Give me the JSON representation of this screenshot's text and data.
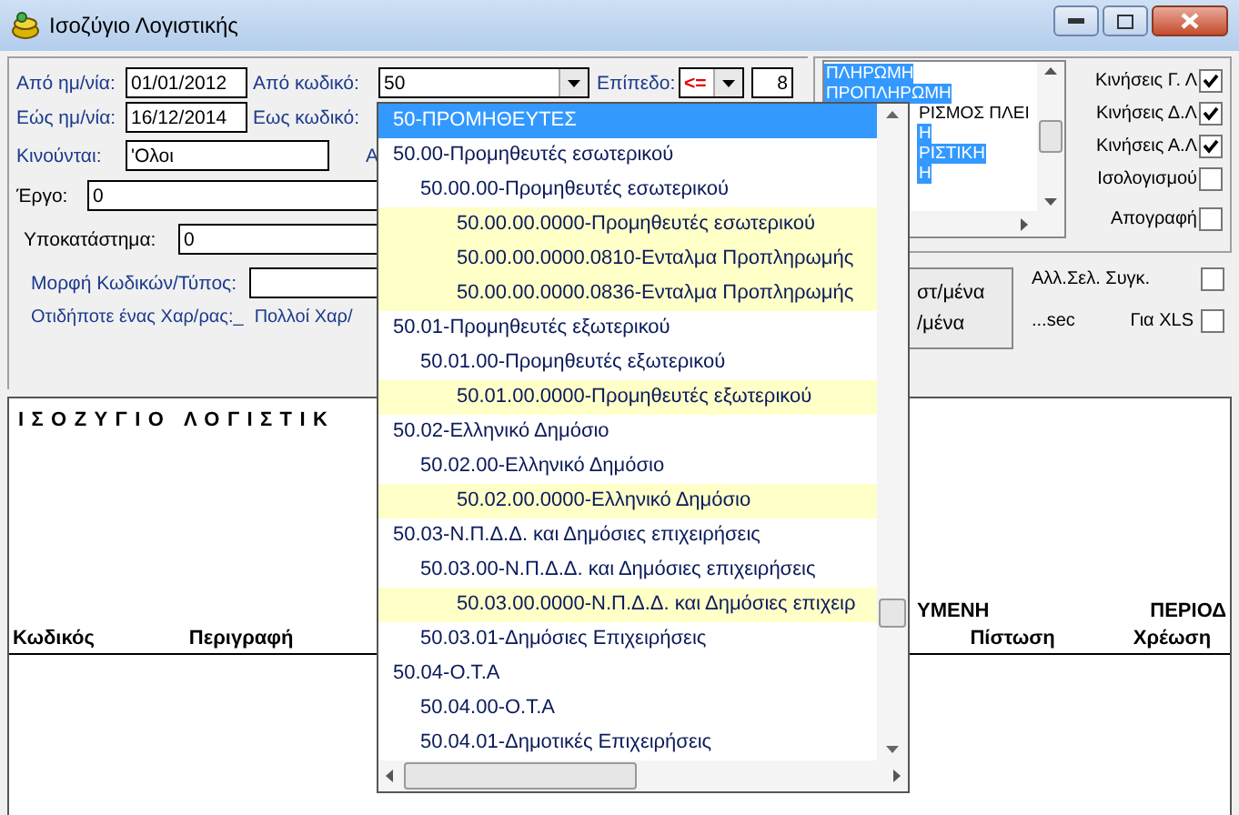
{
  "window": {
    "title": "Ισοζύγιο Λογιστικής"
  },
  "filters": {
    "from_date": {
      "label": "Από ημ/νία:",
      "value": "01/01/2012"
    },
    "from_code": {
      "label": "Από κωδικό:",
      "value": "50"
    },
    "level": {
      "label": "Επίπεδο:",
      "operator": "<=",
      "value": "8"
    },
    "to_date": {
      "label": "Εώς ημ/νία:",
      "value": "16/12/2014"
    },
    "to_code": {
      "label": "Εως κωδικό:"
    },
    "moving": {
      "label": "Κινούνται:",
      "value": "'Ολοι"
    },
    "column_3": "Α",
    "project": {
      "label": "Έργο:",
      "value": "0"
    },
    "branch": {
      "label": "Υποκατάστημα:",
      "value": "0"
    },
    "code_format": {
      "label": "Μορφή Κωδικών/Τύπος:"
    },
    "hint": "Οτιδήποτε ένας Χαρ/ρας:_",
    "hint_2": "Πολλοί Χαρ/"
  },
  "type_list": [
    {
      "label": "ΠΛΗΡΩΜΗ",
      "selected": true
    },
    {
      "label": "ΠΡΟΠΛΗΡΩΜΗ",
      "selected": true
    },
    {
      "label": "ΡΙΣΜΟΣ ΠΛΕΙ",
      "selected": false
    },
    {
      "label": "Η",
      "selected": true
    },
    {
      "label": "ΡΙΣΤΙΚΗ",
      "selected": true
    },
    {
      "label": "Η",
      "selected": true
    }
  ],
  "options": [
    {
      "label": "Κινήσεις Γ. Λ",
      "checked": true
    },
    {
      "label": "Κινήσεις Δ.Λ",
      "checked": true
    },
    {
      "label": "Κινήσεις Α.Λ",
      "checked": true
    },
    {
      "label": "Ισολογισμού",
      "checked": false
    },
    {
      "label": "Απογραφή",
      "checked": false
    }
  ],
  "action_button": {
    "lines": [
      "στ/μένα",
      "/μένα"
    ]
  },
  "page_options": {
    "page_break": {
      "label": "Αλλ.Σελ. Συγκ.",
      "checked": false
    },
    "timer": "...sec",
    "xls": {
      "label": "Για XLS",
      "checked": false
    }
  },
  "report": {
    "title": "ΙΣΟΖΥΓΙΟ ΛΟΓΙΣΤΙΚ",
    "group_headers": [
      "ΥΜΕΝΗ",
      "ΠΕΡΙΟΔ"
    ],
    "columns": [
      "Κωδικός",
      "Περιγραφή",
      "Πίστωση",
      "Χρέωση"
    ]
  },
  "code_dropdown": {
    "items": [
      {
        "label": "50-ΠΡΟΜΗΘΕΥΤΕΣ",
        "selected": true,
        "children": [
          {
            "label": "50.00-Προμηθευτές εσωτερικού",
            "selected": false,
            "children": [
              {
                "label": "50.00.00-Προμηθευτές εσωτερικού",
                "selected": false,
                "children": [
                  {
                    "label": "50.00.00.0000-Προμηθευτές εσωτερικού",
                    "selected": false
                  },
                  {
                    "label": "50.00.00.0000.0810-Ενταλμα Προπληρωμής",
                    "selected": false
                  },
                  {
                    "label": "50.00.00.0000.0836-Ενταλμα Προπληρωμής",
                    "selected": false
                  }
                ]
              }
            ]
          },
          {
            "label": "50.01-Προμηθευτές εξωτερικού",
            "selected": false,
            "children": [
              {
                "label": "50.01.00-Προμηθευτές εξωτερικού",
                "selected": false,
                "children": [
                  {
                    "label": "50.01.00.0000-Προμηθευτές εξωτερικού",
                    "selected": false
                  }
                ]
              }
            ]
          },
          {
            "label": "50.02-Ελληνικό Δημόσιο",
            "selected": false,
            "children": [
              {
                "label": "50.02.00-Ελληνικό Δημόσιο",
                "selected": false,
                "children": [
                  {
                    "label": "50.02.00.0000-Ελληνικό Δημόσιο",
                    "selected": false
                  }
                ]
              }
            ]
          },
          {
            "label": "50.03-Ν.Π.Δ.Δ. και Δημόσιες επιχειρήσεις",
            "selected": false,
            "children": [
              {
                "label": "50.03.00-Ν.Π.Δ.Δ. και Δημόσιες επιχειρήσεις",
                "selected": false,
                "children": [
                  {
                    "label": "50.03.00.0000-Ν.Π.Δ.Δ. και Δημόσιες επιχειρ",
                    "selected": false
                  }
                ]
              },
              {
                "label": "50.03.01-Δημόσιες Επιχειρήσεις",
                "selected": false
              }
            ]
          },
          {
            "label": "50.04-Ο.Τ.Α",
            "selected": false,
            "children": [
              {
                "label": "50.04.00-Ο.Τ.Α",
                "selected": false
              },
              {
                "label": "50.04.01-Δημοτικές Επιχειρήσεις",
                "selected": false
              }
            ]
          }
        ]
      }
    ]
  }
}
